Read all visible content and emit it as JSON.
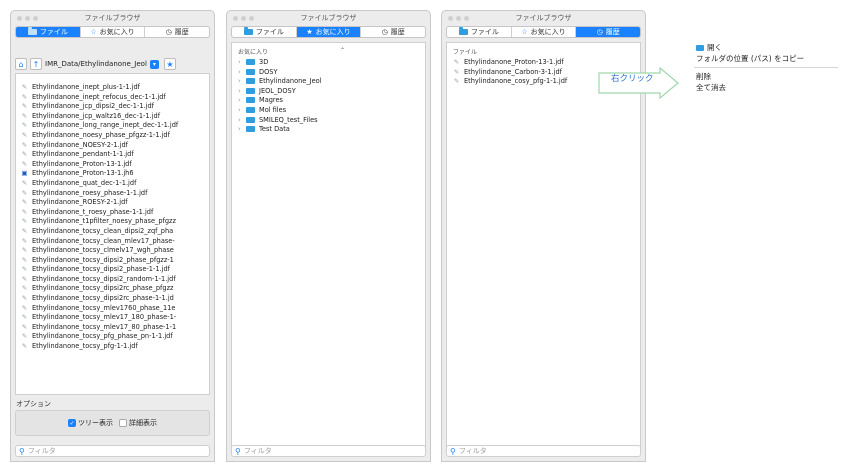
{
  "windows": [
    {
      "title": "ファイルブラウザ",
      "tabs": [
        "ファイル",
        "お気に入り",
        "履歴"
      ],
      "active_tab": 0
    },
    {
      "title": "ファイルブラウザ",
      "tabs": [
        "ファイル",
        "お気に入り",
        "履歴"
      ],
      "active_tab": 1
    },
    {
      "title": "ファイルブラウザ",
      "tabs": [
        "ファイル",
        "お気に入り",
        "履歴"
      ],
      "active_tab": 2
    }
  ],
  "w1": {
    "path": "IMR_Data/Ethylindanone_Jeol",
    "files": [
      "Ethylindanone_inept_plus-1-1.jdf",
      "Ethylindanone_inept_refocus_dec-1-1.jdf",
      "Ethylindanone_jcp_dipsi2_dec-1-1.jdf",
      "Ethylindanone_jcp_waltz16_dec-1-1.jdf",
      "Ethylindanone_long_range_inept_dec-1-1.jdf",
      "Ethylindanone_noesy_phase_pfgzz-1-1.jdf",
      "Ethylindanone_NOESY-2-1.jdf",
      "Ethylindanone_pendant-1-1.jdf",
      "Ethylindanone_Proton-13-1.jdf",
      "Ethylindanone_Proton-13-1.jh6",
      "Ethylindanone_quat_dec-1-1.jdf",
      "Ethylindanone_roesy_phase-1-1.jdf",
      "Ethylindanone_ROESY-2-1.jdf",
      "Ethylindanone_t_roesy_phase-1-1.jdf",
      "Ethylindanone_t1pfilter_noesy_phase_pfgzz",
      "Ethylindanone_tocsy_clean_dipsi2_zqf_pha",
      "Ethylindanone_tocsy_clean_mlev17_phase-",
      "Ethylindanone_tocsy_clmelv17_wgh_phase",
      "Ethylindanone_tocsy_dipsi2_phase_pfgzz-1",
      "Ethylindanone_tocsy_dipsi2_phase-1-1.jdf",
      "Ethylindanone_tocsy_dipsi2_random-1-1.jdf",
      "Ethylindanone_tocsy_dipsi2rc_phase_pfgzz",
      "Ethylindanone_tocsy_dipsi2rc_phase-1-1.jd",
      "Ethylindanone_tocsy_mlev1760_phase_11e",
      "Ethylindanone_tocsy_mlev17_180_phase-1-",
      "Ethylindanone_tocsy_mlev17_80_phase-1-1",
      "Ethylindanone_tocsy_pfg_phase_pn-1-1.jdf",
      "Ethylindanone_tocsy_pfg-1-1.jdf"
    ],
    "options_label": "オプション",
    "tree_label": "ツリー表示",
    "detail_label": "詳細表示"
  },
  "w2": {
    "header": "お気に入り",
    "folders": [
      "3D",
      "DOSY",
      "Ethylindanone_Jeol",
      "JEOL_DOSY",
      "Magres",
      "Mol files",
      "SMILEQ_test_Files",
      "Test Data"
    ]
  },
  "w3": {
    "header": "ファイル",
    "files": [
      "Ethylindanone_Proton-13-1.jdf",
      "Ethylindanone_Carbon-3-1.jdf",
      "Ethylindanone_cosy_pfg-1-1.jdf"
    ]
  },
  "filter_placeholder": "フィルタ",
  "callout": "右クリック",
  "context_menu": {
    "open": "開く",
    "copy_path": "フォルダの位置 (パス) をコピー",
    "delete": "削除",
    "clear_all": "全て消去"
  }
}
